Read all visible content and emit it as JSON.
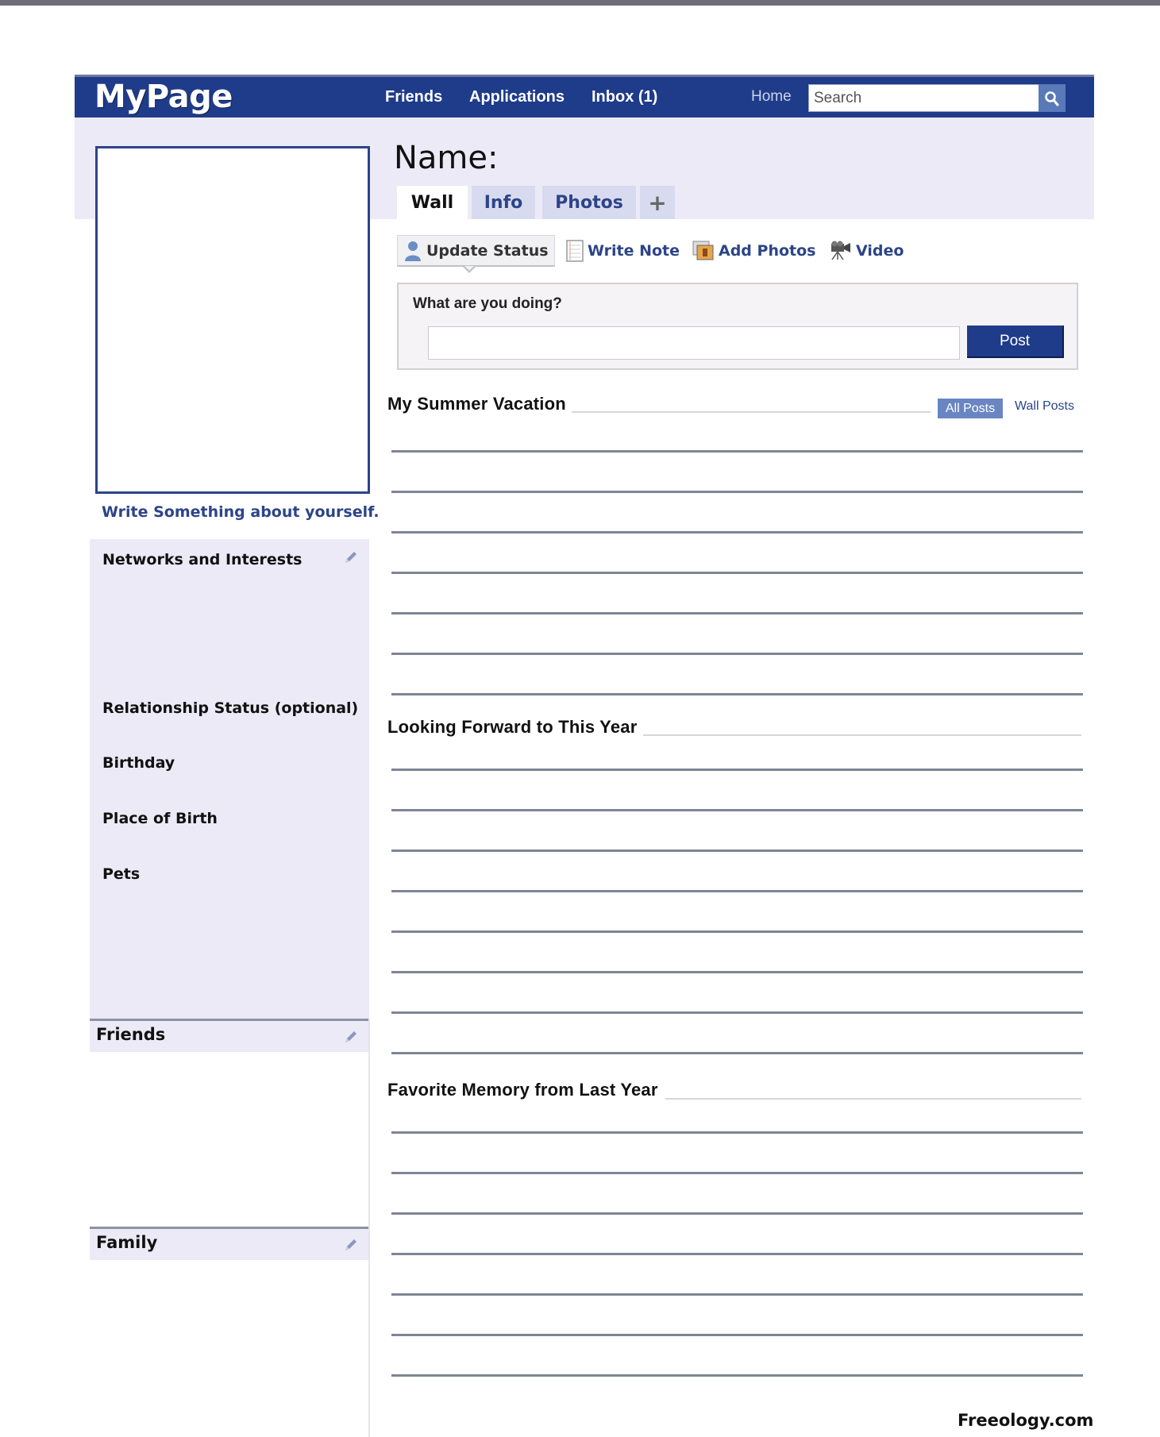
{
  "header": {
    "logo": "MyPage",
    "nav": [
      {
        "label": "Friends"
      },
      {
        "label": "Applications"
      },
      {
        "label": "Inbox (1)"
      }
    ],
    "home_label": "Home",
    "search_placeholder": "Search",
    "search_icon": "magnifier-icon"
  },
  "profile": {
    "name_label": "Name:",
    "about_link": "Write Something about yourself."
  },
  "tabs": [
    {
      "label": "Wall",
      "active": true
    },
    {
      "label": "Info",
      "active": false
    },
    {
      "label": "Photos",
      "active": false
    },
    {
      "label": "+",
      "active": false
    }
  ],
  "actions": [
    {
      "label": "Update Status",
      "icon": "person-icon",
      "selected": true
    },
    {
      "label": "Write Note",
      "icon": "note-icon",
      "selected": false
    },
    {
      "label": "Add Photos",
      "icon": "photos-icon",
      "selected": false
    },
    {
      "label": "Video",
      "icon": "video-camera-icon",
      "selected": false
    }
  ],
  "status": {
    "question": "What are you doing?",
    "input_value": "",
    "post_label": "Post"
  },
  "sidebar": {
    "networks_title": "Networks and Interests",
    "fields": [
      "Relationship Status (optional)",
      "Birthday",
      "Place of Birth",
      "Pets"
    ],
    "friends_title": "Friends",
    "family_title": "Family"
  },
  "wall": {
    "filters": {
      "all_posts": "All Posts",
      "wall_posts": "Wall Posts"
    },
    "sections": [
      {
        "title": "My Summer Vacation",
        "line_count": 7
      },
      {
        "title": "Looking Forward to This Year",
        "line_count": 8
      },
      {
        "title": "Favorite Memory from Last Year",
        "line_count": 7
      }
    ]
  },
  "footer": {
    "credit": "Freeology.com"
  },
  "colors": {
    "brand_blue": "#1f3c8a",
    "link_blue": "#2c4488",
    "lavender": "#eceaf6",
    "line_gray": "#7d8694"
  }
}
